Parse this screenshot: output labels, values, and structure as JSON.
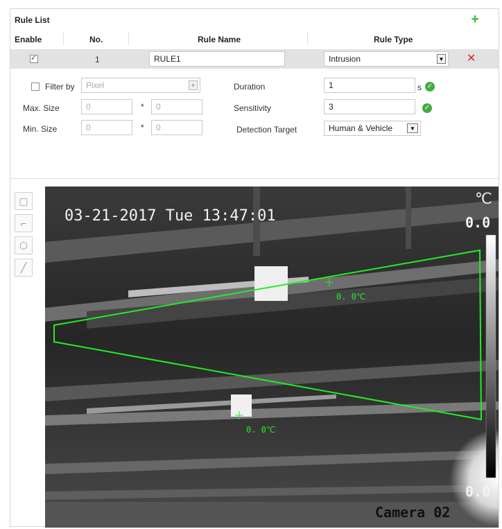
{
  "panel": {
    "title": "Rule List",
    "columns": {
      "enable": "Enable",
      "no": "No.",
      "rule_name": "Rule Name",
      "rule_type": "Rule Type"
    }
  },
  "rule": {
    "enabled": true,
    "number": "1",
    "name": "RULE1",
    "type": "Intrusion"
  },
  "filter": {
    "label": "Filter by",
    "checked": false,
    "value": "Pixel",
    "max_label": "Max. Size",
    "min_label": "Min. Size",
    "max_w": "0",
    "max_h": "0",
    "min_w": "0",
    "min_h": "0",
    "times": "*"
  },
  "params": {
    "duration_label": "Duration",
    "duration_value": "1",
    "duration_unit": "s",
    "sensitivity_label": "Sensitivity",
    "sensitivity_value": "3",
    "target_label": "Detection Target",
    "target_value": "Human & Vehicle"
  },
  "video": {
    "timestamp": "03-21-2017 Tue 13:47:01",
    "unit": "℃",
    "scale_max": "0.0",
    "scale_min": "0.0",
    "temp_point_1": "0. 0℃",
    "temp_point_2": "0. 0℃",
    "camera_name": "Camera 02"
  },
  "colors": {
    "add": "#3cb83c",
    "delete": "#e02020",
    "ok": "#3fae3f",
    "zone": "#22ee22"
  },
  "tools": [
    "rectangle-tool-icon",
    "corner-tool-icon",
    "polygon-tool-icon",
    "line-tool-icon"
  ]
}
